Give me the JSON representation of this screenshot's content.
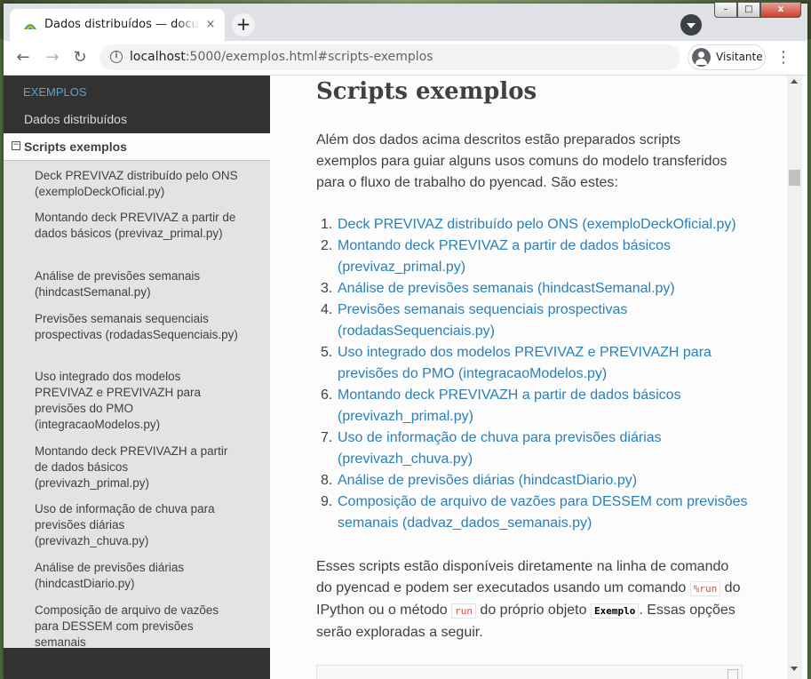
{
  "browser": {
    "tab_title": "Dados distribuídos — documentação",
    "tab_close": "×",
    "new_tab": "+",
    "url_host": "localhost",
    "url_rest": ":5000/exemplos.html#scripts-exemplos",
    "profile_label": "Visitante",
    "menu_icon": "⋮",
    "back_icon": "←",
    "forward_icon": "→",
    "reload_icon": "↻",
    "info_icon": "i"
  },
  "sidebar": {
    "caption": "EXEMPLOS",
    "parent": "Dados distribuídos",
    "current_toggle": "−",
    "current": "Scripts exemplos",
    "items": [
      {
        "label": "Deck PREVIVAZ distribuído pelo ONS (exemploDeckOficial.py)"
      },
      {
        "label": "Montando deck PREVIVAZ a partir de dados básicos (previvaz_primal.py)"
      },
      {
        "label": "Análise de previsões semanais (hindcastSemanal.py)"
      },
      {
        "label": "Previsões semanais sequenciais prospectivas (rodadasSequenciais.py)"
      },
      {
        "label": "Uso integrado dos modelos PREVIVAZ e PREVIVAZH para previsões do PMO (integracaoModelos.py)"
      },
      {
        "label": "Montando deck PREVIVAZH a partir de dados básicos (previvazh_primal.py)"
      },
      {
        "label": "Uso de informação de chuva para previsões diárias (previvazh_chuva.py)"
      },
      {
        "label": "Análise de previsões diárias (hindcastDiario.py)"
      },
      {
        "label": "Composição de arquivo de vazões para DESSEM com previsões semanais"
      }
    ]
  },
  "main": {
    "title": "Scripts exemplos",
    "intro": "Além dos dados acima descritos estão preparados scripts exemplos para guiar alguns usos comuns do modelo transferidos para o fluxo de trabalho do pyencad. São estes:",
    "list": [
      {
        "num": "1.",
        "label": "Deck PREVIVAZ distribuído pelo ONS (exemploDeckOficial.py)"
      },
      {
        "num": "2.",
        "label": "Montando deck PREVIVAZ a partir de dados básicos (previvaz_primal.py)"
      },
      {
        "num": "3.",
        "label": "Análise de previsões semanais (hindcastSemanal.py)"
      },
      {
        "num": "4.",
        "label": "Previsões semanais sequenciais prospectivas (rodadasSequenciais.py)"
      },
      {
        "num": "5.",
        "label": "Uso integrado dos modelos PREVIVAZ e PREVIVAZH para previsões do PMO (integracaoModelos.py)"
      },
      {
        "num": "6.",
        "label": "Montando deck PREVIVAZH a partir de dados básicos (previvazh_primal.py)"
      },
      {
        "num": "7.",
        "label": "Uso de informação de chuva para previsões diárias (previvazh_chuva.py)"
      },
      {
        "num": "8.",
        "label": "Análise de previsões diárias (hindcastDiario.py)"
      },
      {
        "num": "9.",
        "label": "Composição de arquivo de vazões para DESSEM com previsões semanais (dadvaz_dados_semanais.py)"
      }
    ],
    "outro": {
      "part1": "Esses scripts estão disponíveis diretamente na linha de comando do pyencad e podem ser executados usando um comando ",
      "code1": "%run",
      "part2": " do IPython ou o método ",
      "code2": "run",
      "part3": " do próprio objeto ",
      "code3": "Exemplo",
      "part4": ". Essas opções serão exploradas a seguir."
    }
  },
  "colors": {
    "link": "#2980b9",
    "sidebar_bg": "#343131",
    "caption": "#55a5d9"
  }
}
